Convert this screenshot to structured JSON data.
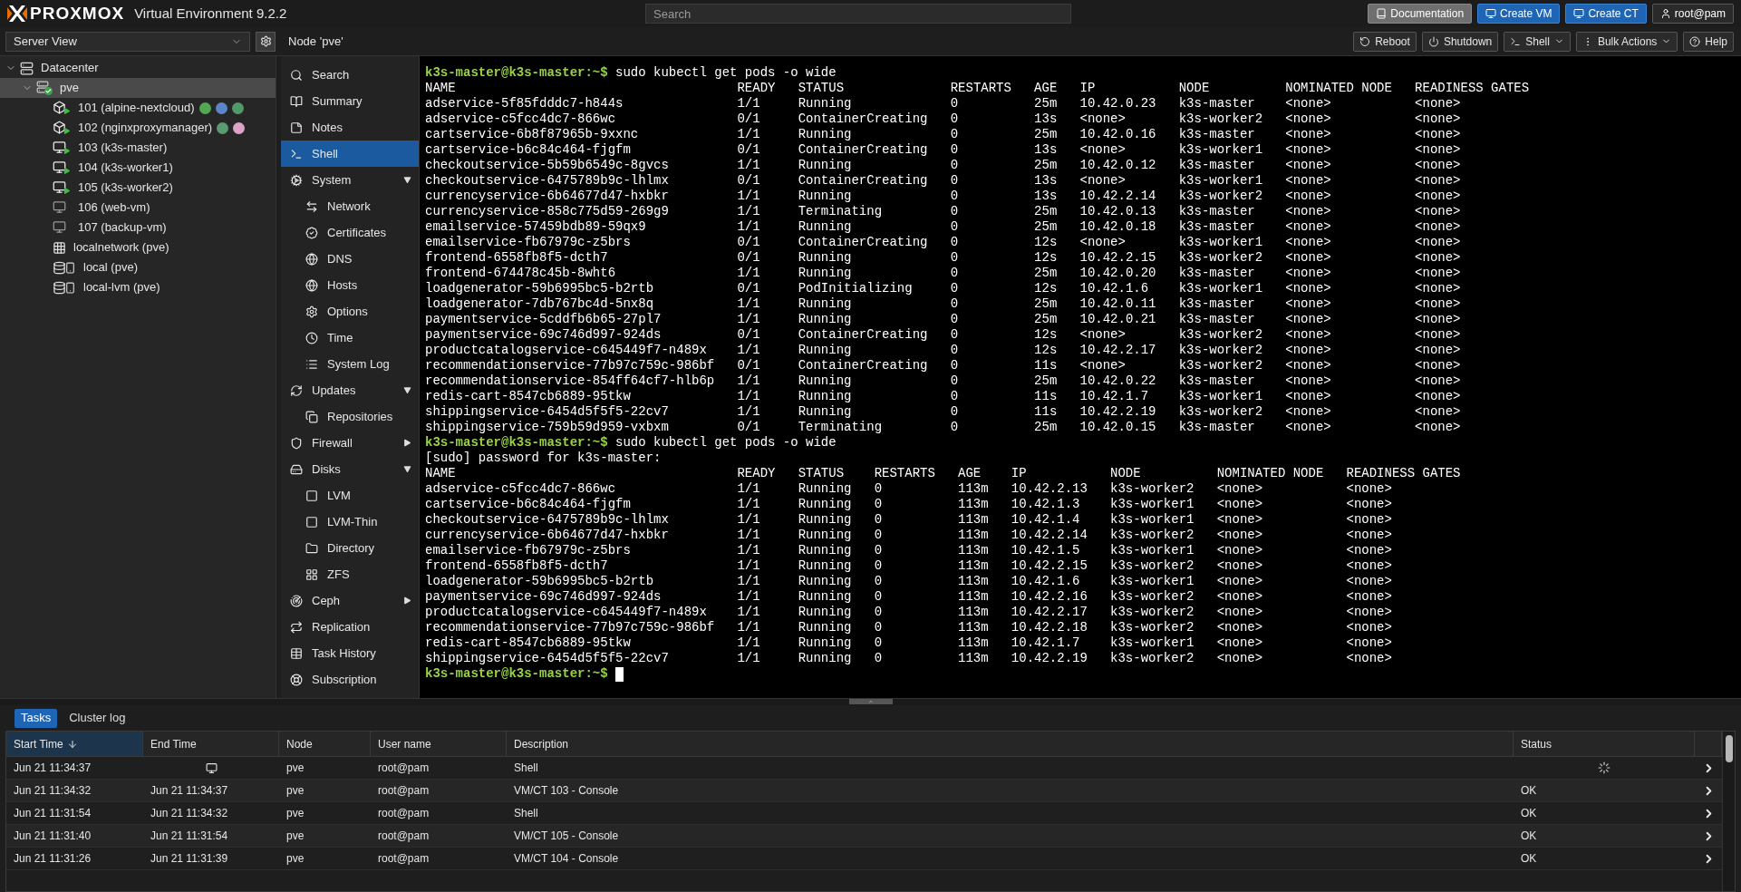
{
  "header": {
    "logo": "PROXMOX",
    "product": "Virtual Environment 9.2.2",
    "search": {
      "placeholder": "Search"
    },
    "buttons": [
      {
        "label": "Documentation",
        "kind": "doc"
      },
      {
        "label": "Create VM",
        "kind": "primary"
      },
      {
        "label": "Create CT",
        "kind": "primary"
      },
      {
        "label": "root@pam",
        "kind": "user"
      }
    ]
  },
  "view_selector": {
    "value": "Server View"
  },
  "tree": [
    {
      "label": "Datacenter",
      "kind": "datacenter",
      "expanded": true,
      "selected": false,
      "children": [
        {
          "label": "pve",
          "kind": "node",
          "expanded": true,
          "selected": true,
          "online": true,
          "children": [
            {
              "label": "101 (alpine-nextcloud)",
              "kind": "container",
              "running": true,
              "selected": false,
              "tags": [
                {
                  "color": "#52a852"
                },
                {
                  "color": "#5a86c8"
                },
                {
                  "color": "#4f9a68"
                }
              ]
            },
            {
              "label": "102 (nginxproxymanager)",
              "kind": "container",
              "running": true,
              "selected": false,
              "tags": [
                {
                  "color": "#5a9a70"
                },
                {
                  "color": "#dba3c8"
                }
              ]
            },
            {
              "label": "103 (k3s-master)",
              "kind": "vm",
              "running": true,
              "selected": false
            },
            {
              "label": "104 (k3s-worker1)",
              "kind": "vm",
              "running": true,
              "selected": false
            },
            {
              "label": "105 (k3s-worker2)",
              "kind": "vm",
              "running": true,
              "selected": false
            },
            {
              "label": "106 (web-vm)",
              "kind": "vm",
              "running": false,
              "selected": false
            },
            {
              "label": "107 (backup-vm)",
              "kind": "vm",
              "running": false,
              "selected": false
            },
            {
              "label": "localnetwork (pve)",
              "kind": "network",
              "selected": false
            },
            {
              "label": "local (pve)",
              "kind": "storage",
              "selected": false
            },
            {
              "label": "local-lvm (pve)",
              "kind": "storage",
              "selected": false
            }
          ]
        }
      ]
    }
  ],
  "content_title": "Node 'pve'",
  "toolbar": [
    {
      "label": "Reboot",
      "menu": false
    },
    {
      "label": "Shutdown",
      "menu": false
    },
    {
      "label": "Shell",
      "menu": true
    },
    {
      "label": "Bulk Actions",
      "menu": true
    },
    {
      "label": "Help",
      "menu": false
    }
  ],
  "nav": [
    {
      "label": "Search",
      "selected": false
    },
    {
      "label": "Summary",
      "selected": false
    },
    {
      "label": "Notes",
      "selected": false
    },
    {
      "label": "Shell",
      "selected": true
    },
    {
      "label": "System",
      "selected": false,
      "expanded": true,
      "children": [
        {
          "label": "Network",
          "selected": false
        },
        {
          "label": "Certificates",
          "selected": false
        },
        {
          "label": "DNS",
          "selected": false
        },
        {
          "label": "Hosts",
          "selected": false
        },
        {
          "label": "Options",
          "selected": false
        },
        {
          "label": "Time",
          "selected": false
        },
        {
          "label": "System Log",
          "selected": false
        }
      ]
    },
    {
      "label": "Updates",
      "selected": false,
      "expanded": true,
      "children": [
        {
          "label": "Repositories",
          "selected": false
        }
      ]
    },
    {
      "label": "Firewall",
      "selected": false,
      "expanded": false
    },
    {
      "label": "Disks",
      "selected": false,
      "expanded": true,
      "children": [
        {
          "label": "LVM",
          "selected": false
        },
        {
          "label": "LVM-Thin",
          "selected": false
        },
        {
          "label": "Directory",
          "selected": false
        },
        {
          "label": "ZFS",
          "selected": false
        }
      ]
    },
    {
      "label": "Ceph",
      "selected": false,
      "expanded": false
    },
    {
      "label": "Replication",
      "selected": false
    },
    {
      "label": "Task History",
      "selected": false
    },
    {
      "label": "Subscription",
      "selected": false
    }
  ],
  "terminal": [
    {
      "kind": "prompt",
      "prompt": "k3s-master@k3s-master:~$",
      "command": "sudo kubectl get pods -o wide"
    },
    {
      "kind": "table",
      "columns": [
        "NAME",
        "READY",
        "STATUS",
        "RESTARTS",
        "AGE",
        "IP",
        "NODE",
        "NOMINATED NODE",
        "READINESS GATES"
      ],
      "rows": [
        [
          "adservice-5f85fdddc7-h844s",
          "1/1",
          "Running",
          "0",
          "25m",
          "10.42.0.23",
          "k3s-master",
          "<none>",
          "<none>"
        ],
        [
          "adservice-c5fcc4dc7-866wc",
          "0/1",
          "ContainerCreating",
          "0",
          "13s",
          "<none>",
          "k3s-worker2",
          "<none>",
          "<none>"
        ],
        [
          "cartservice-6b8f87965b-9xxnc",
          "1/1",
          "Running",
          "0",
          "25m",
          "10.42.0.16",
          "k3s-master",
          "<none>",
          "<none>"
        ],
        [
          "cartservice-b6c84c464-fjgfm",
          "0/1",
          "ContainerCreating",
          "0",
          "13s",
          "<none>",
          "k3s-worker1",
          "<none>",
          "<none>"
        ],
        [
          "checkoutservice-5b59b6549c-8gvcs",
          "1/1",
          "Running",
          "0",
          "25m",
          "10.42.0.12",
          "k3s-master",
          "<none>",
          "<none>"
        ],
        [
          "checkoutservice-6475789b9c-lhlmx",
          "0/1",
          "ContainerCreating",
          "0",
          "13s",
          "<none>",
          "k3s-worker1",
          "<none>",
          "<none>"
        ],
        [
          "currencyservice-6b64677d47-hxbkr",
          "1/1",
          "Running",
          "0",
          "13s",
          "10.42.2.14",
          "k3s-worker2",
          "<none>",
          "<none>"
        ],
        [
          "currencyservice-858c775d59-269g9",
          "1/1",
          "Terminating",
          "0",
          "25m",
          "10.42.0.13",
          "k3s-master",
          "<none>",
          "<none>"
        ],
        [
          "emailservice-57459bdb89-59qx9",
          "1/1",
          "Running",
          "0",
          "25m",
          "10.42.0.18",
          "k3s-master",
          "<none>",
          "<none>"
        ],
        [
          "emailservice-fb67979c-z5brs",
          "0/1",
          "ContainerCreating",
          "0",
          "12s",
          "<none>",
          "k3s-worker1",
          "<none>",
          "<none>"
        ],
        [
          "frontend-6558fb8f5-dcth7",
          "0/1",
          "Running",
          "0",
          "12s",
          "10.42.2.15",
          "k3s-worker2",
          "<none>",
          "<none>"
        ],
        [
          "frontend-674478c45b-8wht6",
          "1/1",
          "Running",
          "0",
          "25m",
          "10.42.0.20",
          "k3s-master",
          "<none>",
          "<none>"
        ],
        [
          "loadgenerator-59b6995bc5-b2rtb",
          "0/1",
          "PodInitializing",
          "0",
          "12s",
          "10.42.1.6",
          "k3s-worker1",
          "<none>",
          "<none>"
        ],
        [
          "loadgenerator-7db767bc4d-5nx8q",
          "1/1",
          "Running",
          "0",
          "25m",
          "10.42.0.11",
          "k3s-master",
          "<none>",
          "<none>"
        ],
        [
          "paymentservice-5cddfb6b65-27pl7",
          "1/1",
          "Running",
          "0",
          "25m",
          "10.42.0.21",
          "k3s-master",
          "<none>",
          "<none>"
        ],
        [
          "paymentservice-69c746d997-924ds",
          "0/1",
          "ContainerCreating",
          "0",
          "12s",
          "<none>",
          "k3s-worker2",
          "<none>",
          "<none>"
        ],
        [
          "productcatalogservice-c645449f7-n489x",
          "1/1",
          "Running",
          "0",
          "12s",
          "10.42.2.17",
          "k3s-worker2",
          "<none>",
          "<none>"
        ],
        [
          "recommendationservice-77b97c759c-986bf",
          "0/1",
          "ContainerCreating",
          "0",
          "11s",
          "<none>",
          "k3s-worker2",
          "<none>",
          "<none>"
        ],
        [
          "recommendationservice-854ff64cf7-hlb6p",
          "1/1",
          "Running",
          "0",
          "25m",
          "10.42.0.22",
          "k3s-master",
          "<none>",
          "<none>"
        ],
        [
          "redis-cart-8547cb6889-95tkw",
          "1/1",
          "Running",
          "0",
          "11s",
          "10.42.1.7",
          "k3s-worker1",
          "<none>",
          "<none>"
        ],
        [
          "shippingservice-6454d5f5f5-22cv7",
          "1/1",
          "Running",
          "0",
          "11s",
          "10.42.2.19",
          "k3s-worker2",
          "<none>",
          "<none>"
        ],
        [
          "shippingservice-759b59d959-vxbxm",
          "0/1",
          "Terminating",
          "0",
          "25m",
          "10.42.0.15",
          "k3s-master",
          "<none>",
          "<none>"
        ]
      ]
    },
    {
      "kind": "prompt",
      "prompt": "k3s-master@k3s-master:~$",
      "command": "sudo kubectl get pods -o wide"
    },
    {
      "kind": "text",
      "text": "[sudo] password for k3s-master:"
    },
    {
      "kind": "table",
      "columns": [
        "NAME",
        "READY",
        "STATUS",
        "RESTARTS",
        "AGE",
        "IP",
        "NODE",
        "NOMINATED NODE",
        "READINESS GATES"
      ],
      "rows": [
        [
          "adservice-c5fcc4dc7-866wc",
          "1/1",
          "Running",
          "0",
          "113m",
          "10.42.2.13",
          "k3s-worker2",
          "<none>",
          "<none>"
        ],
        [
          "cartservice-b6c84c464-fjgfm",
          "1/1",
          "Running",
          "0",
          "113m",
          "10.42.1.3",
          "k3s-worker1",
          "<none>",
          "<none>"
        ],
        [
          "checkoutservice-6475789b9c-lhlmx",
          "1/1",
          "Running",
          "0",
          "113m",
          "10.42.1.4",
          "k3s-worker1",
          "<none>",
          "<none>"
        ],
        [
          "currencyservice-6b64677d47-hxbkr",
          "1/1",
          "Running",
          "0",
          "113m",
          "10.42.2.14",
          "k3s-worker2",
          "<none>",
          "<none>"
        ],
        [
          "emailservice-fb67979c-z5brs",
          "1/1",
          "Running",
          "0",
          "113m",
          "10.42.1.5",
          "k3s-worker1",
          "<none>",
          "<none>"
        ],
        [
          "frontend-6558fb8f5-dcth7",
          "1/1",
          "Running",
          "0",
          "113m",
          "10.42.2.15",
          "k3s-worker2",
          "<none>",
          "<none>"
        ],
        [
          "loadgenerator-59b6995bc5-b2rtb",
          "1/1",
          "Running",
          "0",
          "113m",
          "10.42.1.6",
          "k3s-worker1",
          "<none>",
          "<none>"
        ],
        [
          "paymentservice-69c746d997-924ds",
          "1/1",
          "Running",
          "0",
          "113m",
          "10.42.2.16",
          "k3s-worker2",
          "<none>",
          "<none>"
        ],
        [
          "productcatalogservice-c645449f7-n489x",
          "1/1",
          "Running",
          "0",
          "113m",
          "10.42.2.17",
          "k3s-worker2",
          "<none>",
          "<none>"
        ],
        [
          "recommendationservice-77b97c759c-986bf",
          "1/1",
          "Running",
          "0",
          "113m",
          "10.42.2.18",
          "k3s-worker2",
          "<none>",
          "<none>"
        ],
        [
          "redis-cart-8547cb6889-95tkw",
          "1/1",
          "Running",
          "0",
          "113m",
          "10.42.1.7",
          "k3s-worker1",
          "<none>",
          "<none>"
        ],
        [
          "shippingservice-6454d5f5f5-22cv7",
          "1/1",
          "Running",
          "0",
          "113m",
          "10.42.2.19",
          "k3s-worker2",
          "<none>",
          "<none>"
        ]
      ]
    },
    {
      "kind": "prompt",
      "prompt": "k3s-master@k3s-master:~$",
      "cursor": true
    }
  ],
  "bottom_tabs": [
    {
      "label": "Tasks",
      "selected": true
    },
    {
      "label": "Cluster log",
      "selected": false
    }
  ],
  "tasks": {
    "columns": [
      {
        "label": "Start Time",
        "sorted": true
      },
      {
        "label": "End Time",
        "sorted": false
      },
      {
        "label": "Node",
        "sorted": false
      },
      {
        "label": "User name",
        "sorted": false
      },
      {
        "label": "Description",
        "sorted": false
      },
      {
        "label": "Status",
        "sorted": false
      }
    ],
    "rows": [
      {
        "start": "Jun 21 11:34:37",
        "running": true,
        "node": "pve",
        "user": "root@pam",
        "description": "Shell"
      },
      {
        "start": "Jun 21 11:34:32",
        "end": "Jun 21 11:34:37",
        "running": false,
        "node": "pve",
        "user": "root@pam",
        "description": "VM/CT 103 - Console",
        "status": "OK"
      },
      {
        "start": "Jun 21 11:31:54",
        "end": "Jun 21 11:34:32",
        "running": false,
        "node": "pve",
        "user": "root@pam",
        "description": "Shell",
        "status": "OK"
      },
      {
        "start": "Jun 21 11:31:40",
        "end": "Jun 21 11:31:54",
        "running": false,
        "node": "pve",
        "user": "root@pam",
        "description": "VM/CT 105 - Console",
        "status": "OK"
      },
      {
        "start": "Jun 21 11:31:26",
        "end": "Jun 21 11:31:39",
        "running": false,
        "node": "pve",
        "user": "root@pam",
        "description": "VM/CT 104 - Console",
        "status": "OK"
      }
    ]
  }
}
